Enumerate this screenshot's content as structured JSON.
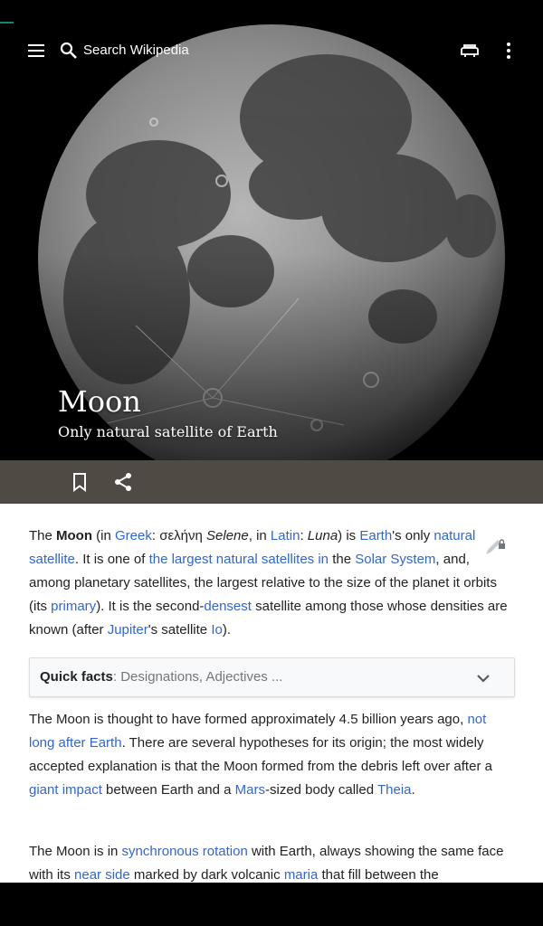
{
  "search": {
    "placeholder": "Search Wikipedia"
  },
  "article": {
    "title": "Moon",
    "description": "Only natural satellite of Earth"
  },
  "icons": {
    "menu": "menu-icon",
    "search": "search-icon",
    "reading_lists": "reading-lists-icon",
    "overflow": "more-vert-icon",
    "bookmark": "bookmark-icon",
    "share": "share-icon",
    "edit": "edit-lock-icon",
    "expand": "chevron-down-icon"
  },
  "paragraph1": {
    "t1": "The ",
    "b1": "Moon",
    "t2": " (in ",
    "l1": "Greek",
    "t3": ": σελήνη ",
    "i1": "Selene",
    "t4": ", in ",
    "l2": "Latin",
    "t5": ": ",
    "i2": "Luna",
    "t6": ") is ",
    "l3": "Earth",
    "t7": "'s only ",
    "l4": "natural satellite",
    "t8": ". It is one of ",
    "l5": "the largest natural satellites in",
    "t9": " the ",
    "l6": "Solar System",
    "t10": ", and, among planetary satellites, the largest relative to the size of the planet it orbits (its ",
    "l7": "primary",
    "t11": "). It is the second-",
    "l8": "densest",
    "t12": " satellite among those whose densities are known (after ",
    "l9": "Jupiter",
    "t13": "'s satellite ",
    "l10": "Io",
    "t14": ")."
  },
  "quick_facts": {
    "label": "Quick facts",
    "summary": ": Designations, Adjectives ..."
  },
  "paragraph2": {
    "t1": "The Moon is thought to have formed approximately 4.5 billion years ago, ",
    "l1": "not long after Earth",
    "t2": ". There are several hypotheses for its origin; the most widely accepted explanation is that the Moon formed from the debris left over after a ",
    "l2": "giant impact",
    "t3": " between Earth and a ",
    "l3": "Mars",
    "t4": "-sized body called ",
    "l4": "Theia",
    "t5": "."
  },
  "paragraph3": {
    "t1": "The Moon is in ",
    "l1": "synchronous rotation",
    "t2": " with Earth, always showing the same face with its ",
    "l2": "near side",
    "t3": " marked by dark volcanic ",
    "l3": "maria",
    "t4": " that fill between the"
  },
  "colors": {
    "link": "#3366cc",
    "text": "#222222",
    "action_bar": "#4f4a44",
    "accent": "#14866d"
  }
}
